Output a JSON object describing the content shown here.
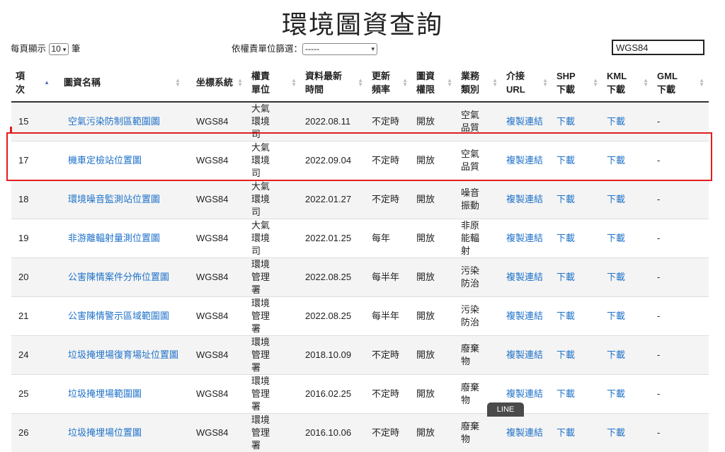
{
  "title": "環境圖資查詢",
  "page_size": {
    "prefix": "每頁顯示",
    "value": "10",
    "suffix": "筆"
  },
  "filter": {
    "label": "依權責單位篩選：",
    "value": "-----"
  },
  "search": {
    "value": "WGS84"
  },
  "columns": [
    "項次",
    "圖資名稱",
    "坐標系統",
    "權責單位",
    "資料最新時間",
    "更新頻率",
    "圖資權限",
    "業務類別",
    "介接URL",
    "SHP下載",
    "KML下載",
    "GML下載"
  ],
  "rows": [
    {
      "no": "15",
      "name": "空氣污染防制區範圍圖",
      "crs": "WGS84",
      "unit": "大氣環境司",
      "date": "2022.08.11",
      "freq": "不定時",
      "perm": "開放",
      "cat": "空氣品質",
      "url": "複製連結",
      "shp": "下載",
      "kml": "下載",
      "gml": "-"
    },
    {
      "no": "17",
      "name": "機車定檢站位置圖",
      "crs": "WGS84",
      "unit": "大氣環境司",
      "date": "2022.09.04",
      "freq": "不定時",
      "perm": "開放",
      "cat": "空氣品質",
      "url": "複製連結",
      "shp": "下載",
      "kml": "下載",
      "gml": "-"
    },
    {
      "no": "18",
      "name": "環境噪音監測站位置圖",
      "crs": "WGS84",
      "unit": "大氣環境司",
      "date": "2022.01.27",
      "freq": "不定時",
      "perm": "開放",
      "cat": "噪音振動",
      "url": "複製連結",
      "shp": "下載",
      "kml": "下載",
      "gml": "-"
    },
    {
      "no": "19",
      "name": "非游離輻射量測位置圖",
      "crs": "WGS84",
      "unit": "大氣環境司",
      "date": "2022.01.25",
      "freq": "每年",
      "perm": "開放",
      "cat": "非原能輻射",
      "url": "複製連結",
      "shp": "下載",
      "kml": "下載",
      "gml": "-"
    },
    {
      "no": "20",
      "name": "公害陳情案件分佈位置圖",
      "crs": "WGS84",
      "unit": "環境管理署",
      "date": "2022.08.25",
      "freq": "每半年",
      "perm": "開放",
      "cat": "污染防治",
      "url": "複製連結",
      "shp": "下載",
      "kml": "下載",
      "gml": "-"
    },
    {
      "no": "21",
      "name": "公害陳情警示區域範圍圖",
      "crs": "WGS84",
      "unit": "環境管理署",
      "date": "2022.08.25",
      "freq": "每半年",
      "perm": "開放",
      "cat": "污染防治",
      "url": "複製連結",
      "shp": "下載",
      "kml": "下載",
      "gml": "-"
    },
    {
      "no": "24",
      "name": "垃圾掩埋場復育場址位置圖",
      "crs": "WGS84",
      "unit": "環境管理署",
      "date": "2018.10.09",
      "freq": "不定時",
      "perm": "開放",
      "cat": "廢棄物",
      "url": "複製連結",
      "shp": "下載",
      "kml": "下載",
      "gml": "-"
    },
    {
      "no": "25",
      "name": "垃圾掩埋場範圍圖",
      "crs": "WGS84",
      "unit": "環境管理署",
      "date": "2016.02.25",
      "freq": "不定時",
      "perm": "開放",
      "cat": "廢棄物",
      "url": "複製連結",
      "shp": "下載",
      "kml": "下載",
      "gml": "-"
    },
    {
      "no": "26",
      "name": "垃圾掩埋場位置圖",
      "crs": "WGS84",
      "unit": "環境管理署",
      "date": "2016.10.06",
      "freq": "不定時",
      "perm": "開放",
      "cat": "廢棄物",
      "url": "複製連結",
      "shp": "下載",
      "kml": "下載",
      "gml": "-"
    }
  ],
  "line_tab": "LINE",
  "colors": {
    "link": "#1f72c9",
    "highlight": "#e21e1e",
    "sort_active": "#5b6fb8"
  }
}
